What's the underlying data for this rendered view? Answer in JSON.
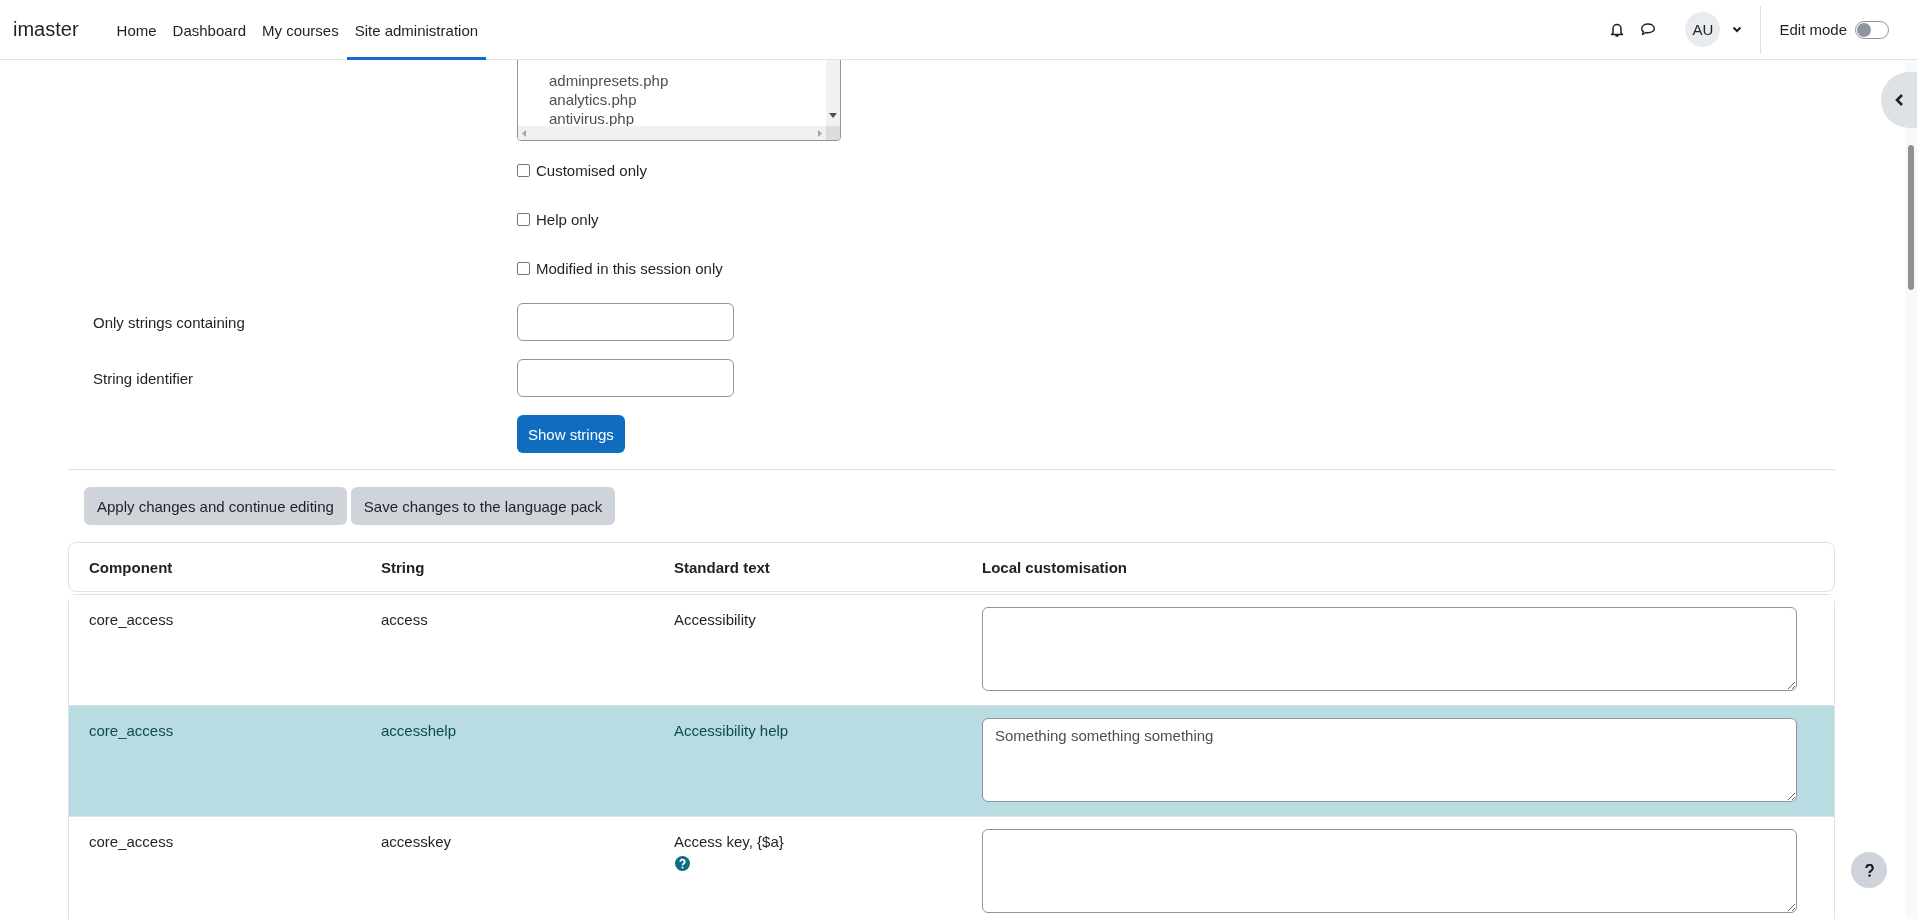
{
  "navbar": {
    "brand": "imaster",
    "items": [
      {
        "label": "Home",
        "selected": false
      },
      {
        "label": "Dashboard",
        "selected": false
      },
      {
        "label": "My courses",
        "selected": false
      },
      {
        "label": "Site administration",
        "selected": true
      }
    ],
    "user_initials": "AU",
    "edit_mode": {
      "label": "Edit mode",
      "on": false
    }
  },
  "filter": {
    "files": [
      "adminpresets.php",
      "analytics.php",
      "antivirus.php"
    ],
    "checkboxes": [
      {
        "label": "Customised only",
        "checked": false
      },
      {
        "label": "Help only",
        "checked": false
      },
      {
        "label": "Modified in this session only",
        "checked": false
      }
    ],
    "fields": [
      {
        "label": "Only strings containing"
      },
      {
        "label": "String identifier"
      }
    ],
    "submit": "Show strings"
  },
  "actions": [
    "Apply changes and continue editing",
    "Save changes to the language pack"
  ],
  "table": {
    "columns": [
      "Component",
      "String",
      "Standard text",
      "Local customisation"
    ],
    "rows": [
      {
        "component": "core_access",
        "string": "access",
        "standard_text": "Accessibility",
        "has_help": false,
        "customisation": "",
        "highlighted": false
      },
      {
        "component": "core_access",
        "string": "accesshelp",
        "standard_text": "Accessibility help",
        "has_help": false,
        "customisation": "Something something something",
        "highlighted": true
      },
      {
        "component": "core_access",
        "string": "accesskey",
        "standard_text": "Access key, {$a}",
        "has_help": true,
        "customisation": "",
        "highlighted": false
      }
    ]
  }
}
